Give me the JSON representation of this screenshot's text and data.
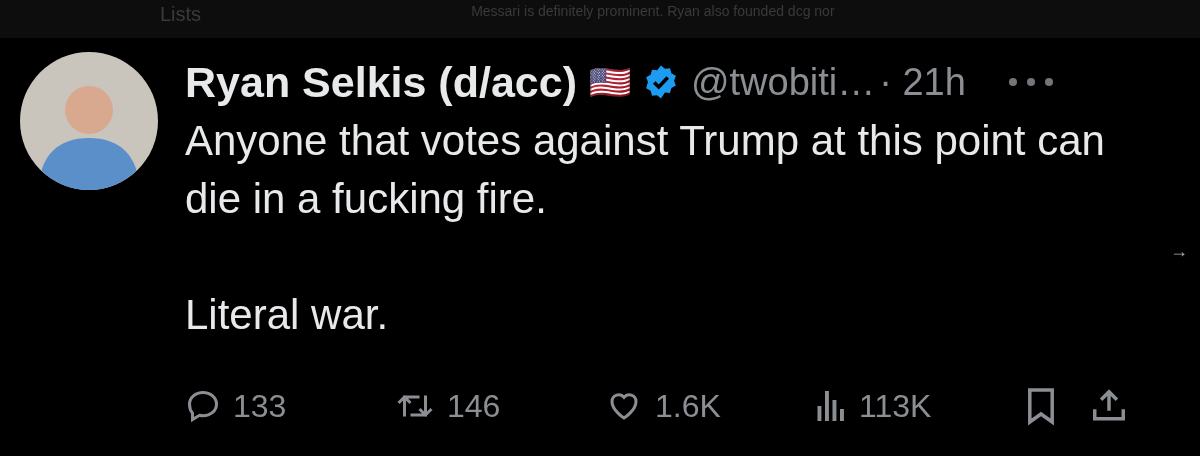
{
  "background_page": {
    "nav_item": "Lists",
    "tweet_text": "Messari is definitely prominent. Ryan also founded dcg nor"
  },
  "tweet": {
    "name": "Ryan Selkis (d/acc)",
    "flag": "🇺🇸",
    "verified": true,
    "handle": "@twobiti…",
    "time": "· 21h",
    "body": [
      "Anyone that votes against Trump at this point can die in a fucking fire.",
      "Literal war."
    ],
    "actions": [
      {
        "kind": "reply",
        "count": "133"
      },
      {
        "kind": "repost",
        "count": "146"
      },
      {
        "kind": "like",
        "count": "1.6K"
      },
      {
        "kind": "views",
        "count": "113K"
      },
      {
        "kind": "bookmark"
      },
      {
        "kind": "share"
      }
    ]
  },
  "side_arrow": "→"
}
